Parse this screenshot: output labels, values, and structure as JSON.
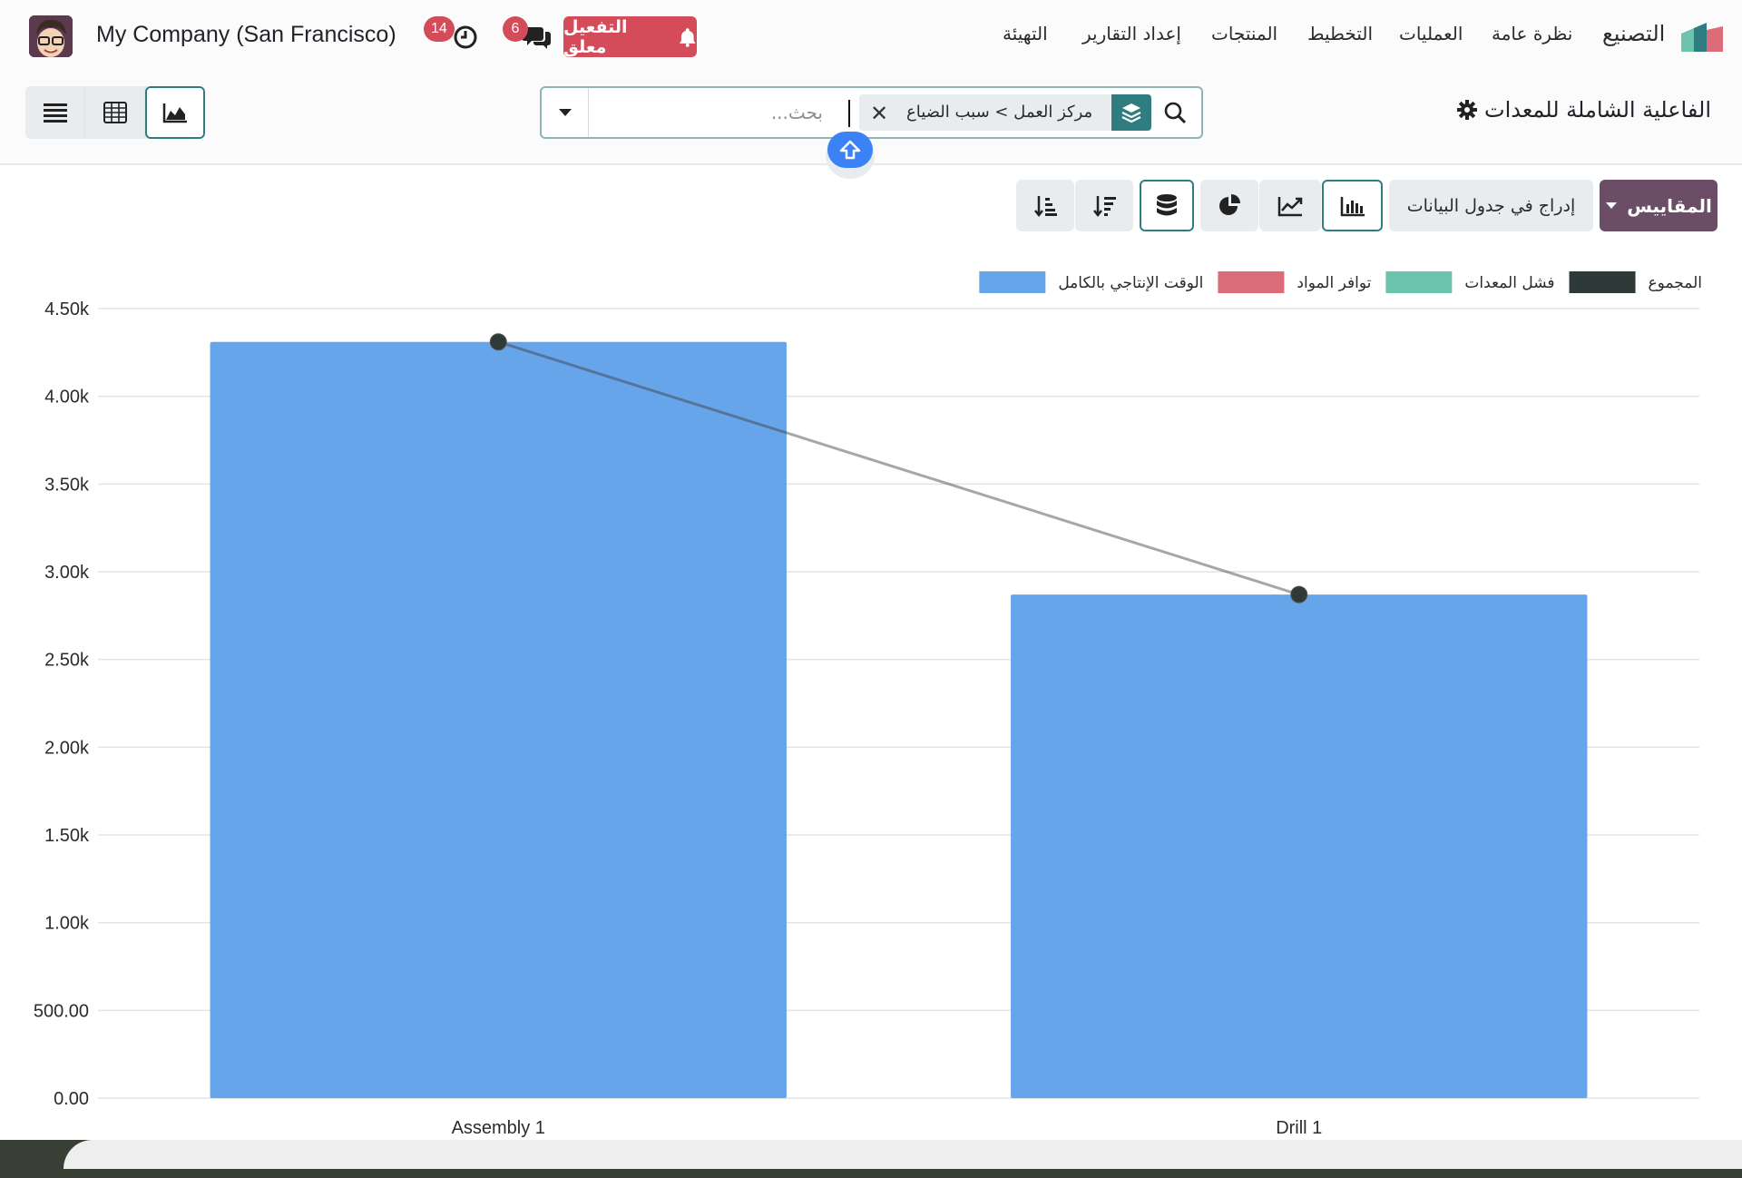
{
  "navbar": {
    "company": "My Company (San Francisco)",
    "activity_count": "14",
    "messages_count": "6",
    "activation_label": "التفعيل معلق",
    "app_name": "التصنيع",
    "menu": [
      "نظرة عامة",
      "العمليات",
      "التخطيط",
      "المنتجات",
      "إعداد التقارير",
      "التهيئة"
    ]
  },
  "control_panel": {
    "title": "الفاعلية الشاملة للمعدات",
    "search": {
      "placeholder": "بحث...",
      "facet_path": "مركز العمل > سبب الضياع"
    },
    "views": [
      "list-view",
      "pivot-view",
      "graph-view"
    ],
    "active_view": "graph-view"
  },
  "toolbar": {
    "measures_label": "المقاييس",
    "insert_label": "إدراج في جدول البيانات"
  },
  "colors": {
    "accent": "#2f7d81",
    "primary": "#6b4e66",
    "danger": "#d44c59",
    "bar_blue": "#67a5ea"
  },
  "chart_data": {
    "type": "bar",
    "categories": [
      "Assembly 1",
      "Drill 1"
    ],
    "series": [
      {
        "name": "الوقت الإنتاجي بالكامل",
        "color": "#67a5ea",
        "values": [
          4310,
          2870
        ]
      },
      {
        "name": "توافر المواد",
        "color": "#dc6d78",
        "values": [
          0,
          0
        ]
      },
      {
        "name": "فشل المعدات",
        "color": "#6cc3ae",
        "values": [
          0,
          0
        ]
      },
      {
        "name": "المجموع",
        "color": "#2f3a38",
        "type": "line",
        "values": [
          4310,
          2870
        ]
      }
    ],
    "y_ticks": [
      "0.00",
      "500.00",
      "1.00k",
      "1.50k",
      "2.00k",
      "2.50k",
      "3.00k",
      "3.50k",
      "4.00k",
      "4.50k"
    ],
    "ylim": [
      0,
      4500
    ],
    "grid": true,
    "legend_position": "top-right"
  }
}
